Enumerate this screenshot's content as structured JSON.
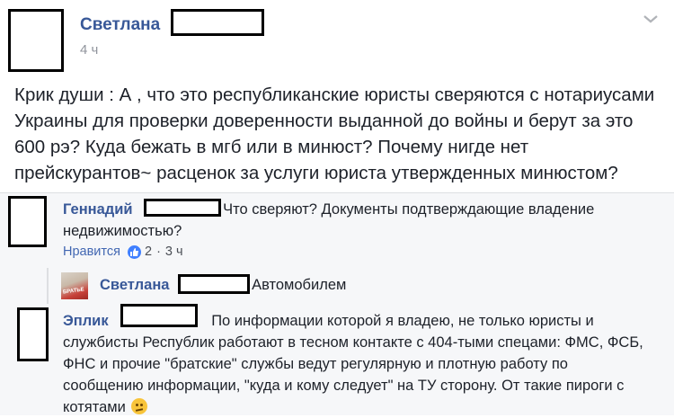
{
  "post": {
    "author": "Светлана",
    "time": "4 ч",
    "text": "Крик души : А , что это республиканские юристы сверяются с нотариусами Украины для проверки доверенности выданной до войны и берут за это 600 рэ? Куда бежать в мгб или в минюст? Почему нигде нет прейскурантов~ расценок за услуги юриста утвержденных минюстом?"
  },
  "comments": [
    {
      "author": "Геннадий",
      "text": "Что сверяют? Документы подтверждающие владение недвижимостью?",
      "like_label": "Нравится",
      "reactions": "2",
      "separator": "·",
      "time": "3 ч"
    },
    {
      "author": "Светлана",
      "text": "Автомобилем"
    },
    {
      "author": "Эплик",
      "text": "По информации которой я владею, не только юристы и службисты Республик работают в тесном контакте с 404-тыми спецами: ФМС, ФСБ, ФНС и прочие \"братские\" службы ведут регулярную и плотную работу по сообщению информации, \"куда и кому следует\" на ТУ сторону.",
      "text_end": "От такие пироги с котятами"
    }
  ],
  "thumb_caption": "БРАТЬЕ",
  "icons": [
    "chevron-down-icon",
    "like-reaction-icon",
    "confused-emoji-icon"
  ],
  "colors": {
    "link": "#385898",
    "meta": "#90949c",
    "like": "#4080ff",
    "comment_bg": "#f6f7f9"
  }
}
